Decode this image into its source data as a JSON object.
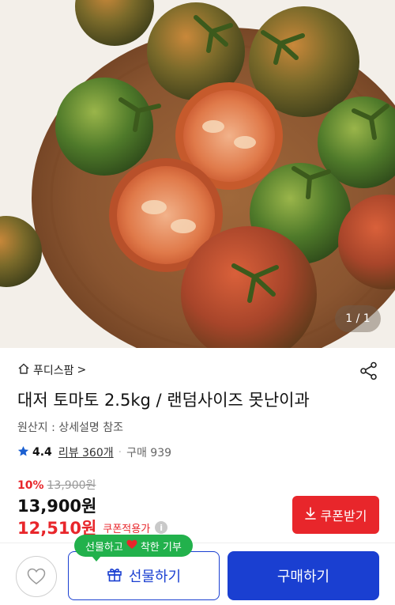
{
  "hero": {
    "image_subject": "tomatoes on wooden plate",
    "counter": "1 / 1"
  },
  "product": {
    "store_name": "푸디스팜",
    "store_chevron": ">",
    "title": "대저 토마토 2.5kg / 랜덤사이즈 못난이과",
    "origin": "원산지 : 상세설명 참조",
    "rating": "4.4",
    "reviews": "리뷰 360개",
    "separator": "·",
    "orders": "구매 939"
  },
  "pricing": {
    "discount_rate": "10%",
    "original_price": "13,900원",
    "price": "13,900원",
    "coupon_price": "12,510원",
    "coupon_label": "쿠폰적용가",
    "info_glyph": "i",
    "coupon_button": "쿠폰받기",
    "accent_color": "#e8262b"
  },
  "bottom": {
    "tooltip_left": "선물하고",
    "tooltip_right": "착한 기부",
    "gift_button": "선물하기",
    "buy_button": "구매하기",
    "brand_color": "#1a3fd1",
    "tooltip_color": "#22b14c"
  }
}
